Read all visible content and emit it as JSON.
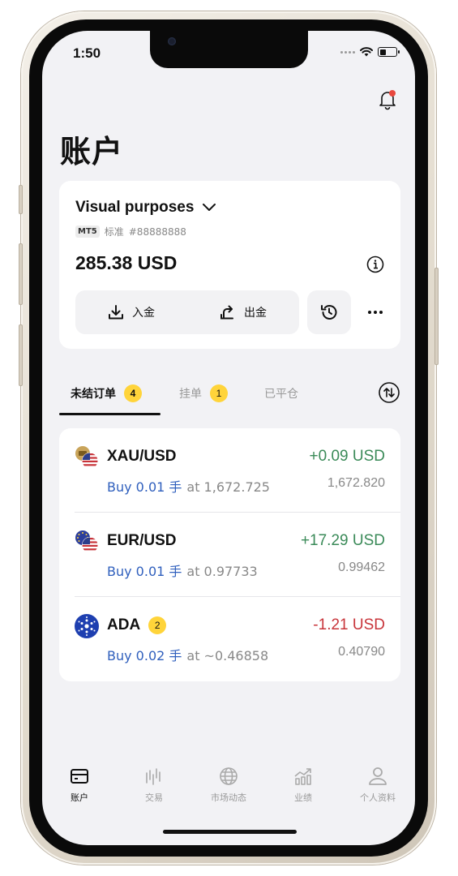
{
  "status_bar": {
    "time": "1:50"
  },
  "page_title": "账户",
  "account": {
    "name": "Visual purposes",
    "platform_badge": "MT5",
    "type_label": "标准",
    "number": "#88888888",
    "balance": "285.38 USD",
    "deposit_label": "入金",
    "withdraw_label": "出金"
  },
  "tabs": [
    {
      "label": "未结订单",
      "badge": "4",
      "active": true
    },
    {
      "label": "挂单",
      "badge": "1",
      "active": false
    },
    {
      "label": "已平仓",
      "active": false
    }
  ],
  "positions": [
    {
      "symbol": "XAU/USD",
      "pnl": "+0.09 USD",
      "pnl_sign": "positive",
      "direction": "Buy 0.01 手",
      "open_price": "at 1,672.725",
      "current_price": "1,672.820",
      "icon": "gold-usd-icon"
    },
    {
      "symbol": "EUR/USD",
      "pnl": "+17.29 USD",
      "pnl_sign": "positive",
      "direction": "Buy 0.01 手",
      "open_price": "at 0.97733",
      "current_price": "0.99462",
      "icon": "eur-usd-icon"
    },
    {
      "symbol": "ADA",
      "count": "2",
      "pnl": "-1.21 USD",
      "pnl_sign": "negative",
      "direction": "Buy 0.02 手",
      "open_price": "at ~0.46858",
      "current_price": "0.40790",
      "icon": "cardano-icon"
    }
  ],
  "bottom_nav": [
    {
      "label": "账户",
      "icon": "wallet-icon",
      "active": true
    },
    {
      "label": "交易",
      "icon": "candles-icon",
      "active": false
    },
    {
      "label": "市场动态",
      "icon": "globe-icon",
      "active": false
    },
    {
      "label": "业绩",
      "icon": "performance-icon",
      "active": false
    },
    {
      "label": "个人资料",
      "icon": "person-icon",
      "active": false
    }
  ],
  "colors": {
    "positive": "#3a8a58",
    "negative": "#c8343a",
    "link": "#2f5fbd",
    "badge": "#ffd43a"
  }
}
